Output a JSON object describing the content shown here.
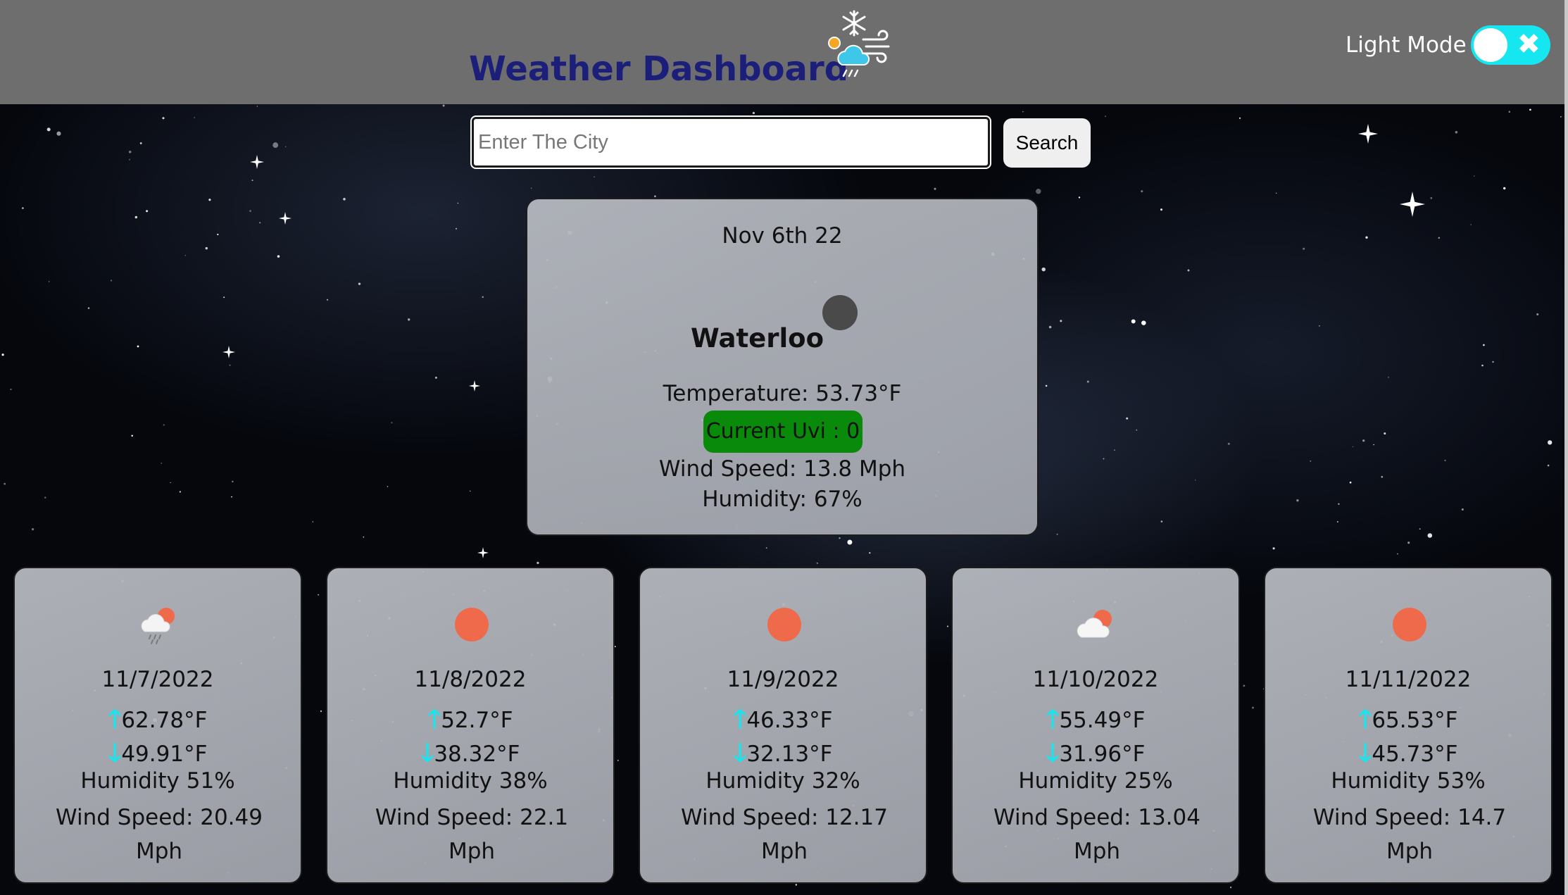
{
  "header": {
    "title": "Weather Dashboard",
    "mode_label": "Light Mode",
    "toggle_symbol": "✖"
  },
  "search": {
    "placeholder": "Enter The City",
    "value": "",
    "button_label": "Search"
  },
  "current": {
    "date": "Nov 6th 22",
    "city": "Waterloo",
    "temperature": "Temperature: 53.73°F",
    "uvi": "Current Uvi : 0",
    "wind": "Wind Speed: 13.8 Mph",
    "humidity": "Humidity: 67%",
    "icon": "moon-icon",
    "uvi_color": "#0a8a0a"
  },
  "forecast": [
    {
      "date": "11/7/2022",
      "high": "62.78°F",
      "low": "49.91°F",
      "humidity": "Humidity 51%",
      "wind": "Wind Speed: 20.49 Mph",
      "icon": "rain-icon"
    },
    {
      "date": "11/8/2022",
      "high": "52.7°F",
      "low": "38.32°F",
      "humidity": "Humidity 38%",
      "wind": "Wind Speed: 22.1 Mph",
      "icon": "sun-icon"
    },
    {
      "date": "11/9/2022",
      "high": "46.33°F",
      "low": "32.13°F",
      "humidity": "Humidity 32%",
      "wind": "Wind Speed: 12.17 Mph",
      "icon": "sun-icon"
    },
    {
      "date": "11/10/2022",
      "high": "55.49°F",
      "low": "31.96°F",
      "humidity": "Humidity 25%",
      "wind": "Wind Speed: 13.04 Mph",
      "icon": "partly-cloudy-icon"
    },
    {
      "date": "11/11/2022",
      "high": "65.53°F",
      "low": "45.73°F",
      "humidity": "Humidity 53%",
      "wind": "Wind Speed: 14.7 Mph",
      "icon": "sun-icon"
    }
  ],
  "arrows": {
    "up": "🡑",
    "down": "🡓"
  },
  "colors": {
    "accent": "#16e6f0",
    "title": "#1c1f7a",
    "header_bg": "#6e6e6e",
    "sun": "#ef6a4a"
  }
}
